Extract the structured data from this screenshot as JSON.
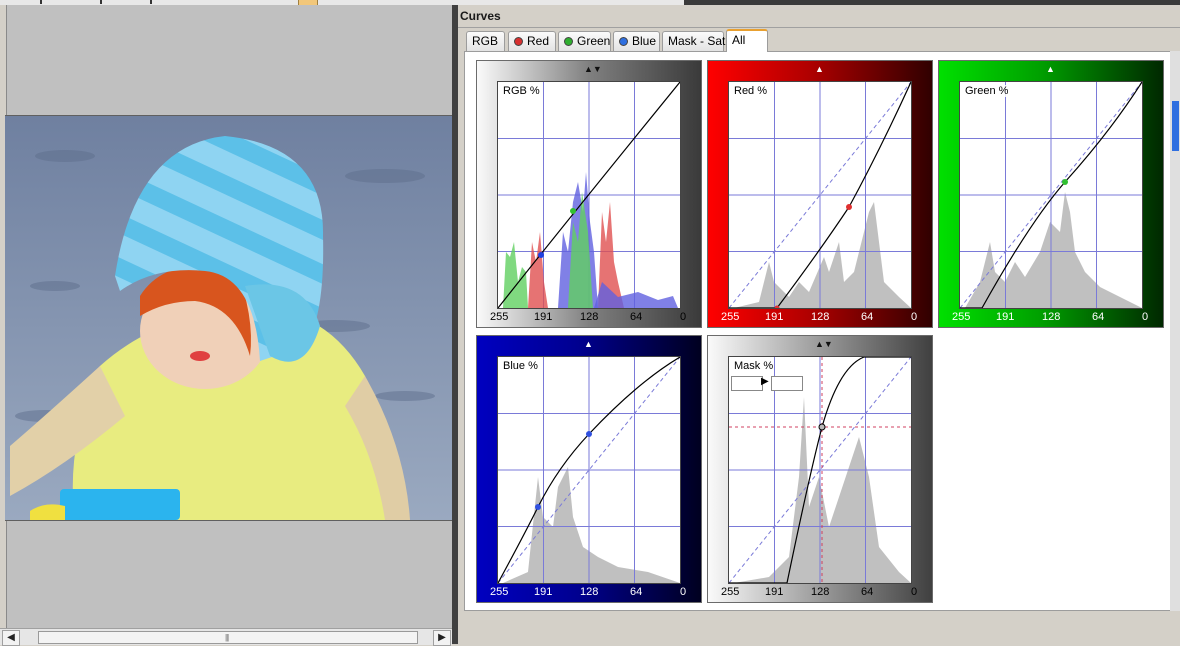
{
  "panel": {
    "title": "Curves"
  },
  "tabs": [
    {
      "label": "RGB",
      "dot": null
    },
    {
      "label": "Red",
      "dot": "#d83030"
    },
    {
      "label": "Green",
      "dot": "#2fae2f"
    },
    {
      "label": "Blue",
      "dot": "#2f6fe0"
    },
    {
      "label": "Mask - Sat",
      "dot": null
    },
    {
      "label": "All",
      "dot": null,
      "active": true
    }
  ],
  "curves": {
    "rgb": {
      "label": "RGB %",
      "color": "#808080"
    },
    "red": {
      "label": "Red %",
      "color": "#c00000"
    },
    "green": {
      "label": "Green %",
      "color": "#00b000"
    },
    "blue": {
      "label": "Blue %",
      "color": "#0000a0"
    },
    "mask": {
      "label": "Mask %",
      "color": "#707070"
    },
    "x_ticks": [
      "255",
      "191",
      "128",
      "64",
      "0"
    ]
  },
  "icons": {
    "curve_handle": "up-down-arrow-icon",
    "mask_arrow": "right-arrow-icon"
  },
  "scrollbar": {
    "left_btn": "◀",
    "right_btn": "▶",
    "grip": "|||"
  }
}
